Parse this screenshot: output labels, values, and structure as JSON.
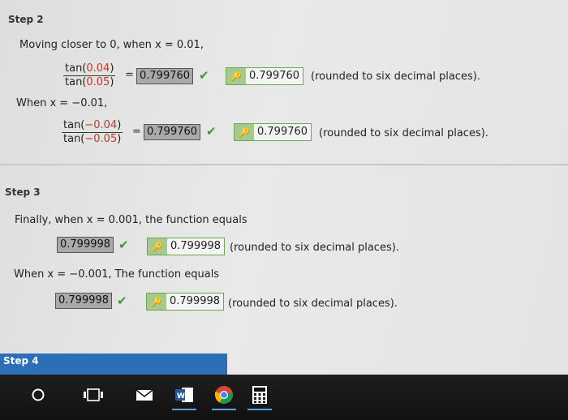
{
  "step2": {
    "heading": "Step 2",
    "intro": "Moving closer to 0, when x = 0.01,",
    "row1": {
      "num_prefix": "tan(",
      "num_value": "0.04",
      "num_suffix": ")",
      "den_prefix": "tan(",
      "den_value": "0.05",
      "den_suffix": ")",
      "eq": "=",
      "answer": "0.799760",
      "key_value": "0.799760",
      "note": "(rounded to six decimal places)."
    },
    "when_neg": "When x = −0.01,",
    "row2": {
      "num_prefix": "tan(",
      "num_value": "−0.04",
      "num_suffix": ")",
      "den_prefix": "tan(",
      "den_value": "−0.05",
      "den_suffix": ")",
      "eq": "=",
      "answer": "0.799760",
      "key_value": "0.799760",
      "note": "(rounded to six decimal places)."
    }
  },
  "step3": {
    "heading": "Step 3",
    "line1": "Finally, when x = 0.001, the function equals",
    "row1": {
      "answer": "0.799998",
      "key_value": "0.799998",
      "note": "(rounded to six decimal places)."
    },
    "line2": "When x = −0.001, The function equals",
    "row2": {
      "answer": "0.799998",
      "key_value": "0.799998",
      "note": "(rounded to six decimal places)."
    }
  },
  "step4": {
    "heading": "Step 4"
  },
  "icons": {
    "check": "✔",
    "key": "🔑"
  },
  "colors": {
    "red_value": "#c0392b",
    "check_green": "#3d9a2e",
    "step4_bar": "#2c6fb6"
  }
}
